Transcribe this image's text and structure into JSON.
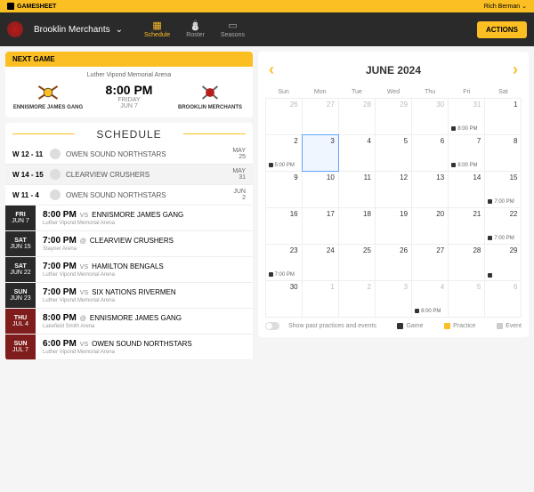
{
  "topbar": {
    "brand": "GAMESHEET",
    "user": "Rich Berman"
  },
  "nav": {
    "team": "Brooklin Merchants",
    "tabs": [
      {
        "label": "Schedule",
        "active": true
      },
      {
        "label": "Roster",
        "active": false
      },
      {
        "label": "Seasons",
        "active": false
      }
    ],
    "actions": "ACTIONS"
  },
  "next": {
    "header": "NEXT GAME",
    "arena": "Luther Vipond Memorial Arena",
    "away": "ENNISMORE JAMES GANG",
    "home": "BROOKLIN MERCHANTS",
    "time": "8:00 PM",
    "day": "FRIDAY",
    "date": "JUN 7"
  },
  "schedule_title": "SCHEDULE",
  "past": [
    {
      "score": "W 12 - 11",
      "opponent": "OWEN SOUND NORTHSTARS",
      "m": "MAY",
      "d": "25"
    },
    {
      "score": "W 14 - 15",
      "opponent": "CLEARVIEW CRUSHERS",
      "m": "MAY",
      "d": "31"
    },
    {
      "score": "W 11 - 4",
      "opponent": "OWEN SOUND NORTHSTARS",
      "m": "JUN",
      "d": "2"
    }
  ],
  "upcoming": [
    {
      "dow": "FRI",
      "date": "JUN 7",
      "time": "8:00 PM",
      "at": "VS",
      "opp": "ENNISMORE JAMES GANG",
      "arena": "Luther Vipond Memorial Arena",
      "red": false
    },
    {
      "dow": "SAT",
      "date": "JUN 15",
      "time": "7:00 PM",
      "at": "@",
      "opp": "CLEARVIEW CRUSHERS",
      "arena": "Stayner Arena",
      "red": false
    },
    {
      "dow": "SAT",
      "date": "JUN 22",
      "time": "7:00 PM",
      "at": "VS",
      "opp": "HAMILTON BENGALS",
      "arena": "Luther Vipond Memorial Arena",
      "red": false
    },
    {
      "dow": "SUN",
      "date": "JUN 23",
      "time": "7:00 PM",
      "at": "VS",
      "opix": "",
      "opp": "SIX NATIONS RIVERMEN",
      "arena": "Luther Vipond Memorial Arena",
      "red": false
    },
    {
      "dow": "THU",
      "date": "JUL 4",
      "time": "8:00 PM",
      "at": "@",
      "opp": "ENNISMORE JAMES GANG",
      "arena": "Lakefield Smith Arena",
      "red": true
    },
    {
      "dow": "SUN",
      "date": "JUL 7",
      "time": "6:00 PM",
      "at": "VS",
      "opp": "OWEN SOUND NORTHSTARS",
      "arena": "Luther Vipond Memorial Arena",
      "red": true
    }
  ],
  "calendar": {
    "month": "JUNE 2024",
    "dow": [
      "Sun",
      "Mon",
      "Tue",
      "Wed",
      "Thu",
      "Fri",
      "Sat"
    ],
    "cells": [
      {
        "n": 26,
        "muted": true
      },
      {
        "n": 27,
        "muted": true
      },
      {
        "n": 28,
        "muted": true
      },
      {
        "n": 29,
        "muted": true
      },
      {
        "n": 30,
        "muted": true
      },
      {
        "n": 31,
        "muted": true,
        "ev": "8:00 PM"
      },
      {
        "n": 1
      },
      {
        "n": 2,
        "ev": "5:00 PM"
      },
      {
        "n": 3,
        "selected": true
      },
      {
        "n": 4
      },
      {
        "n": 5
      },
      {
        "n": 6
      },
      {
        "n": 7,
        "ev": "8:00 PM"
      },
      {
        "n": 8
      },
      {
        "n": 9
      },
      {
        "n": 10
      },
      {
        "n": 11
      },
      {
        "n": 12
      },
      {
        "n": 13
      },
      {
        "n": 14
      },
      {
        "n": 15,
        "ev": "7:00 PM"
      },
      {
        "n": 16
      },
      {
        "n": 17
      },
      {
        "n": 18
      },
      {
        "n": 19
      },
      {
        "n": 20
      },
      {
        "n": 21
      },
      {
        "n": 22,
        "ev": "7:00 PM"
      },
      {
        "n": 23,
        "ev": "7:00 PM"
      },
      {
        "n": 24
      },
      {
        "n": 25
      },
      {
        "n": 26
      },
      {
        "n": 27
      },
      {
        "n": 28
      },
      {
        "n": 29,
        "dot": true
      },
      {
        "n": 30
      },
      {
        "n": 1,
        "muted": true
      },
      {
        "n": 2,
        "muted": true
      },
      {
        "n": 3,
        "muted": true
      },
      {
        "n": 4,
        "muted": true,
        "ev": "8:00 PM"
      },
      {
        "n": 5,
        "muted": true
      },
      {
        "n": 6,
        "muted": true
      }
    ],
    "toggle_label": "Show past practices and events",
    "legend": {
      "game": "Game",
      "practice": "Practice",
      "event": "Event"
    }
  }
}
